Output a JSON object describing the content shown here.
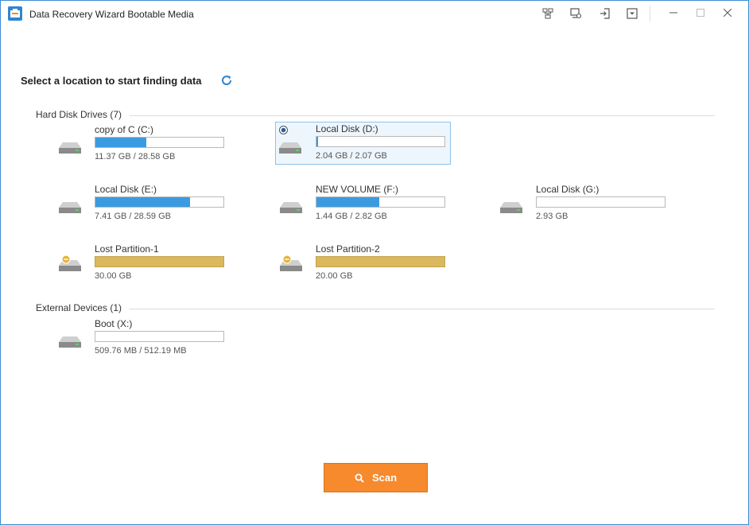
{
  "app": {
    "title": "Data Recovery Wizard Bootable Media",
    "accent": "#3a9be1"
  },
  "toolbar": {
    "icons": [
      "network-icon",
      "computer-settings-icon",
      "sign-in-icon",
      "dropdown-menu-icon"
    ]
  },
  "heading": "Select a location to start finding data",
  "sections": {
    "hdd": {
      "title": "Hard Disk Drives (7)"
    },
    "external": {
      "title": "External Devices (1)"
    }
  },
  "drives": [
    {
      "name": "copy of C (C:)",
      "size": "11.37 GB / 28.58 GB",
      "used_fraction": 0.4,
      "type": "disk"
    },
    {
      "name": "Local Disk (D:)",
      "size": "2.04 GB / 2.07 GB",
      "used_fraction": 0.01,
      "type": "disk",
      "selected": true
    },
    {
      "name": "Local Disk (E:)",
      "size": "7.41 GB / 28.59 GB",
      "used_fraction": 0.74,
      "type": "disk"
    },
    {
      "name": "NEW VOLUME (F:)",
      "size": "1.44 GB / 2.82 GB",
      "used_fraction": 0.49,
      "type": "disk"
    },
    {
      "name": "Local Disk (G:)",
      "size": "2.93 GB",
      "used_fraction": 0.0,
      "type": "disk"
    },
    {
      "name": "Lost Partition-1",
      "size": "30.00 GB",
      "used_fraction": 1.0,
      "type": "lost"
    },
    {
      "name": "Lost Partition-2",
      "size": "20.00 GB",
      "used_fraction": 1.0,
      "type": "lost"
    },
    {
      "name": "Boot (X:)",
      "size": "509.76 MB / 512.19 MB",
      "used_fraction": 0.0,
      "type": "disk"
    }
  ],
  "scan": {
    "label": "Scan",
    "color": "#f68a2d"
  }
}
